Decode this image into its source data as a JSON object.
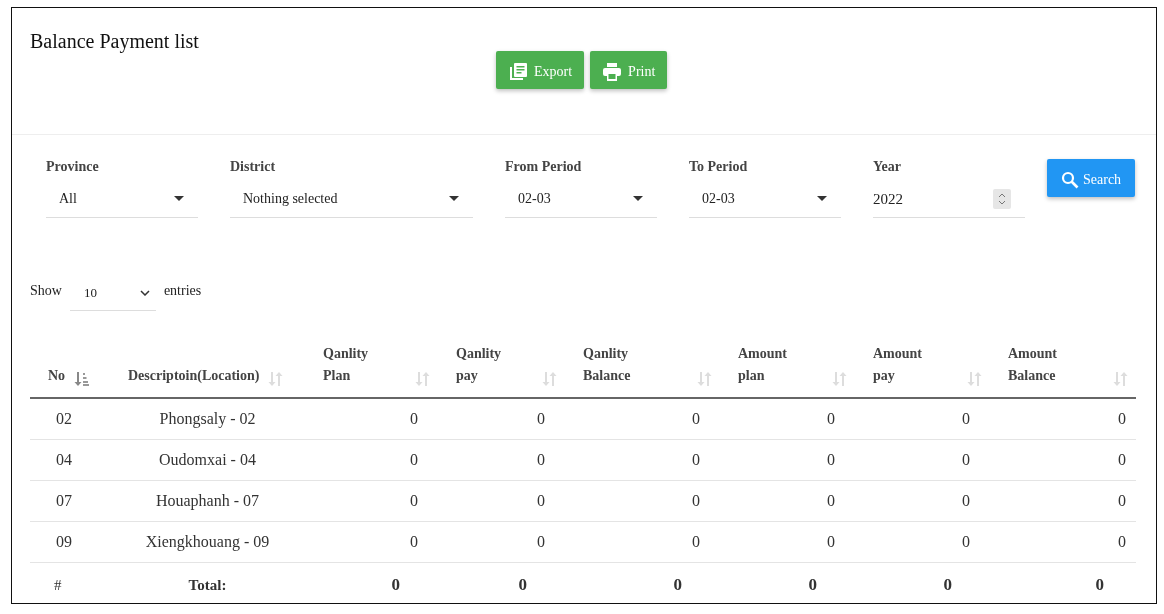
{
  "title": "Balance Payment list",
  "actions": [
    {
      "kind": "export",
      "label": "Export"
    },
    {
      "kind": "print",
      "label": "Print"
    }
  ],
  "filters": [
    {
      "label": "Province",
      "value": "All",
      "kind": "select"
    },
    {
      "label": "District",
      "value": "Nothing selected",
      "kind": "select"
    },
    {
      "label": "From Period",
      "value": "02-03",
      "kind": "select"
    },
    {
      "label": "To Period",
      "value": "02-03",
      "kind": "select"
    },
    {
      "label": "Year",
      "value": "2022",
      "kind": "number"
    }
  ],
  "search_button": "Search",
  "length": {
    "before": "Show",
    "value": "10",
    "after": "entries"
  },
  "table": {
    "columns": [
      {
        "label": "No",
        "sorted": true
      },
      {
        "label": "Descriptoin(Location)",
        "sorted": false
      },
      {
        "label": "Qanlity Plan",
        "sorted": false
      },
      {
        "label": "Qanlity pay",
        "sorted": false
      },
      {
        "label": "Qanlity Balance",
        "sorted": false
      },
      {
        "label": "Amount plan",
        "sorted": false
      },
      {
        "label": "Amount pay",
        "sorted": false
      },
      {
        "label": "Amount Balance",
        "sorted": false
      }
    ],
    "rows": [
      [
        "02",
        "Phongsaly - 02",
        "0",
        "0",
        "0",
        "0",
        "0",
        "0"
      ],
      [
        "04",
        "Oudomxai - 04",
        "0",
        "0",
        "0",
        "0",
        "0",
        "0"
      ],
      [
        "07",
        "Houaphanh - 07",
        "0",
        "0",
        "0",
        "0",
        "0",
        "0"
      ],
      [
        "09",
        "Xiengkhouang - 09",
        "0",
        "0",
        "0",
        "0",
        "0",
        "0"
      ]
    ],
    "footer": [
      "#",
      "Total:",
      "0",
      "0",
      "0",
      "0",
      "0",
      "0"
    ]
  }
}
